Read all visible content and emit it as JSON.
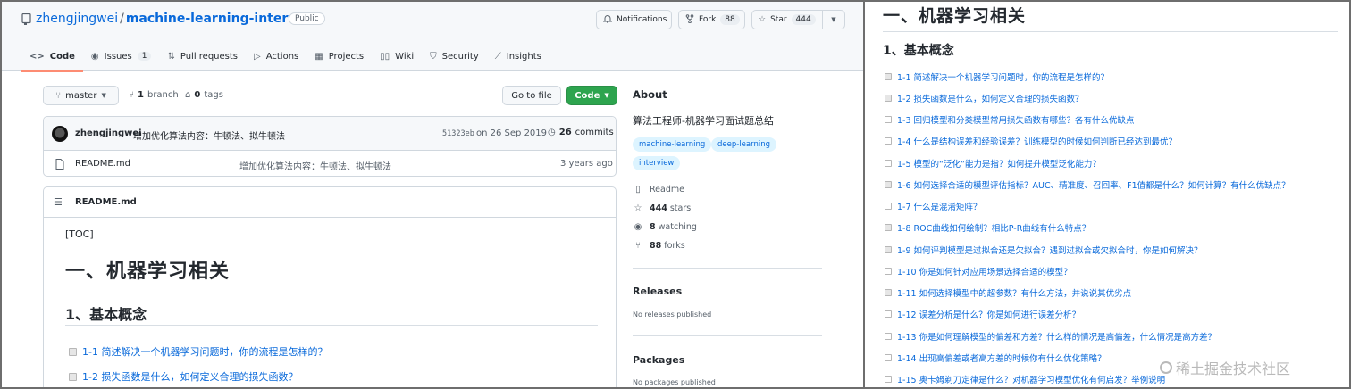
{
  "repo": {
    "owner": "zhengjingwei",
    "separator": "/",
    "name": "machine-learning-interview",
    "visibility": "Public"
  },
  "header_actions": {
    "notifications": "Notifications",
    "fork_label": "Fork",
    "fork_count": "88",
    "star_label": "Star",
    "star_count": "444"
  },
  "tabs": [
    {
      "label": "Code",
      "icon": "code-icon"
    },
    {
      "label": "Issues",
      "icon": "issue-icon",
      "count": "1"
    },
    {
      "label": "Pull requests",
      "icon": "pull-request-icon"
    },
    {
      "label": "Actions",
      "icon": "play-icon"
    },
    {
      "label": "Projects",
      "icon": "table-icon"
    },
    {
      "label": "Wiki",
      "icon": "book-icon"
    },
    {
      "label": "Security",
      "icon": "shield-icon"
    },
    {
      "label": "Insights",
      "icon": "graph-icon"
    }
  ],
  "branch_bar": {
    "branch": "master",
    "branches_count": "1",
    "branches_label": "branch",
    "tags_count": "0",
    "tags_label": "tags",
    "go_to_file": "Go to file",
    "code_button": "Code"
  },
  "latest_commit": {
    "author": "zhengjingwei",
    "message": "增加优化算法内容：牛顿法、拟牛顿法",
    "hash": "51323eb",
    "date": "on 26 Sep 2019",
    "commits_count": "26",
    "commits_label": "commits"
  },
  "files": [
    {
      "name": "README.md",
      "message": "增加优化算法内容：牛顿法、拟牛顿法",
      "age": "3 years ago"
    }
  ],
  "readme": {
    "title": "README.md",
    "toc": "[TOC]",
    "h1": "一、机器学习相关",
    "h2": "1、基本概念",
    "items": [
      {
        "text": "1-1 简述解决一个机器学习问题时，你的流程是怎样的？",
        "checked": true
      },
      {
        "text": "1-2 损失函数是什么，如何定义合理的损失函数？",
        "checked": true
      }
    ]
  },
  "about": {
    "title": "About",
    "description": "算法工程师-机器学习面试题总结",
    "topics": [
      "machine-learning",
      "deep-learning",
      "interview"
    ],
    "readme": "Readme",
    "stars_count": "444",
    "stars_label": "stars",
    "watching_count": "8",
    "watching_label": "watching",
    "forks_count": "88",
    "forks_label": "forks",
    "releases_title": "Releases",
    "releases_text": "No releases published",
    "packages_title": "Packages",
    "packages_text": "No packages published"
  },
  "right_panel": {
    "h1": "一、机器学习相关",
    "h2": "1、基本概念",
    "items": [
      {
        "text": "1-1 简述解决一个机器学习问题时，你的流程是怎样的？",
        "checked": true
      },
      {
        "text": "1-2 损失函数是什么，如何定义合理的损失函数？",
        "checked": true
      },
      {
        "text": "1-3 回归模型和分类模型常用损失函数有哪些？各有什么优缺点",
        "checked": false
      },
      {
        "text": "1-4 什么是结构误差和经验误差？训练模型的时候如何判断已经达到最优？",
        "checked": false
      },
      {
        "text": "1-5 模型的“泛化”能力是指？如何提升模型泛化能力？",
        "checked": false
      },
      {
        "text": "1-6 如何选择合适的模型评估指标？AUC、精准度、召回率、F1值都是什么？如何计算？有什么优缺点？",
        "checked": true
      },
      {
        "text": "1-7 什么是混淆矩阵？",
        "checked": false
      },
      {
        "text": "1-8 ROC曲线如何绘制？相比P-R曲线有什么特点？",
        "checked": true
      },
      {
        "text": "1-9 如何评判模型是过拟合还是欠拟合？遇到过拟合或欠拟合时，你是如何解决？",
        "checked": true
      },
      {
        "text": "1-10 你是如何针对应用场景选择合适的模型？",
        "checked": false
      },
      {
        "text": "1-11 如何选择模型中的超参数？有什么方法，并说说其优劣点",
        "checked": true
      },
      {
        "text": "1-12 误差分析是什么？你是如何进行误差分析？",
        "checked": false
      },
      {
        "text": "1-13 你是如何理解模型的偏差和方差？什么样的情况是高偏差，什么情况是高方差？",
        "checked": false
      },
      {
        "text": "1-14 出现高偏差或者高方差的时候你有什么优化策略？",
        "checked": false
      },
      {
        "text": "1-15 奥卡姆剃刀定律是什么？对机器学习模型优化有何启发？举例说明",
        "checked": false
      }
    ],
    "watermark": "稀土掘金技术社区"
  }
}
